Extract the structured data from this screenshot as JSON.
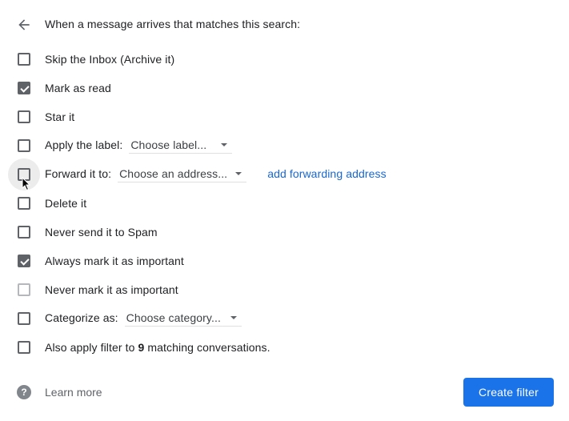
{
  "header": {
    "back_icon": "arrow-left-icon",
    "text": "When a message arrives that matches this search:"
  },
  "options": [
    {
      "id": "skip-inbox",
      "label": "Skip the Inbox (Archive it)",
      "checked": false,
      "disabled": false
    },
    {
      "id": "mark-read",
      "label": "Mark as read",
      "checked": true,
      "disabled": false
    },
    {
      "id": "star",
      "label": "Star it",
      "checked": false,
      "disabled": false
    },
    {
      "id": "apply-label",
      "label": "Apply the label:",
      "checked": false,
      "disabled": false,
      "select": "Choose label..."
    },
    {
      "id": "forward",
      "label": "Forward it to:",
      "checked": false,
      "disabled": false,
      "select": "Choose an address...",
      "link": "add forwarding address",
      "hovered": true
    },
    {
      "id": "delete",
      "label": "Delete it",
      "checked": false,
      "disabled": false
    },
    {
      "id": "never-spam",
      "label": "Never send it to Spam",
      "checked": false,
      "disabled": false
    },
    {
      "id": "always-important",
      "label": "Always mark it as important",
      "checked": true,
      "disabled": false
    },
    {
      "id": "never-important",
      "label": "Never mark it as important",
      "checked": false,
      "disabled": true
    },
    {
      "id": "categorize",
      "label": "Categorize as:",
      "checked": false,
      "disabled": false,
      "select": "Choose category..."
    },
    {
      "id": "also-apply",
      "label_prefix": "Also apply filter to ",
      "count": "9",
      "label_suffix": " matching conversations.",
      "checked": false,
      "disabled": false
    }
  ],
  "footer": {
    "help_icon": "?",
    "learn_more": "Learn more",
    "create_filter": "Create filter"
  },
  "colors": {
    "primary": "#1a73e8",
    "link": "#1967d2",
    "checkbox": "#5f6368"
  }
}
